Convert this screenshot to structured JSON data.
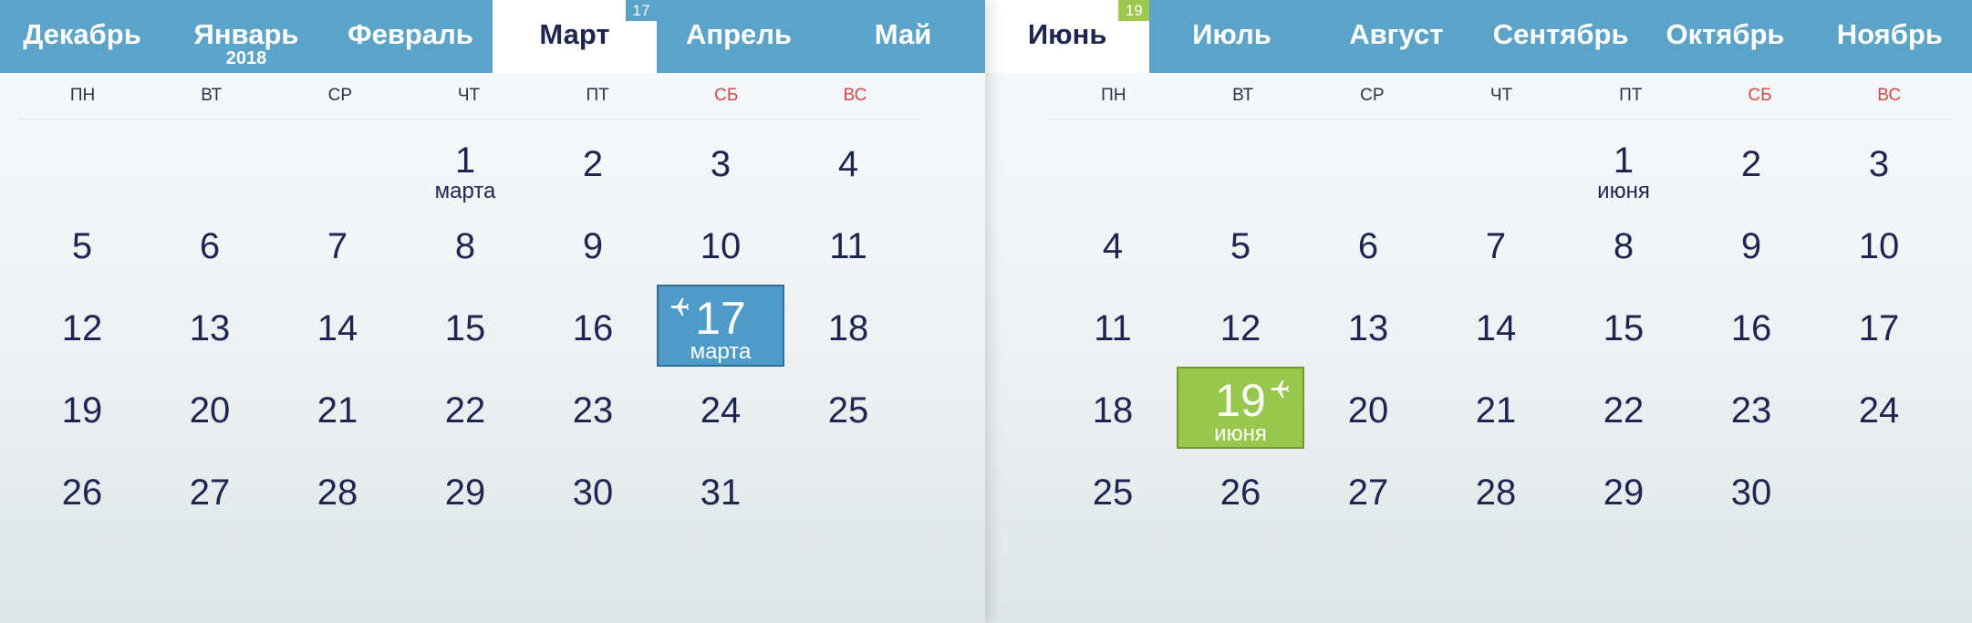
{
  "departure": {
    "tabs": [
      {
        "label": "Декабрь"
      },
      {
        "label": "Январь",
        "year": "2018"
      },
      {
        "label": "Февраль"
      },
      {
        "label": "Март",
        "active": true,
        "badge": "17"
      },
      {
        "label": "Апрель"
      },
      {
        "label": "Май"
      }
    ],
    "weekdays": [
      {
        "label": "ПН"
      },
      {
        "label": "ВТ"
      },
      {
        "label": "СР"
      },
      {
        "label": "ЧТ"
      },
      {
        "label": "ПТ"
      },
      {
        "label": "СБ",
        "weekend": true
      },
      {
        "label": "ВС",
        "weekend": true
      }
    ],
    "days": [
      {
        "empty": true
      },
      {
        "empty": true
      },
      {
        "empty": true
      },
      {
        "num": "1",
        "sub": "марта"
      },
      {
        "num": "2"
      },
      {
        "num": "3"
      },
      {
        "num": "4"
      },
      {
        "num": "5"
      },
      {
        "num": "6"
      },
      {
        "num": "7"
      },
      {
        "num": "8"
      },
      {
        "num": "9"
      },
      {
        "num": "10"
      },
      {
        "num": "11"
      },
      {
        "num": "12"
      },
      {
        "num": "13"
      },
      {
        "num": "14"
      },
      {
        "num": "15"
      },
      {
        "num": "16"
      },
      {
        "num": "17",
        "sub": "марта",
        "selected": true
      },
      {
        "num": "18"
      },
      {
        "num": "19"
      },
      {
        "num": "20"
      },
      {
        "num": "21"
      },
      {
        "num": "22"
      },
      {
        "num": "23"
      },
      {
        "num": "24"
      },
      {
        "num": "25"
      },
      {
        "num": "26"
      },
      {
        "num": "27"
      },
      {
        "num": "28"
      },
      {
        "num": "29"
      },
      {
        "num": "30"
      },
      {
        "num": "31"
      }
    ]
  },
  "return": {
    "tabs": [
      {
        "label": "Июнь",
        "active": true,
        "badge": "19"
      },
      {
        "label": "Июль"
      },
      {
        "label": "Август"
      },
      {
        "label": "Сентябрь"
      },
      {
        "label": "Октябрь"
      },
      {
        "label": "Ноябрь"
      }
    ],
    "weekdays": [
      {
        "label": "ПН"
      },
      {
        "label": "ВТ"
      },
      {
        "label": "СР"
      },
      {
        "label": "ЧТ"
      },
      {
        "label": "ПТ"
      },
      {
        "label": "СБ",
        "weekend": true
      },
      {
        "label": "ВС",
        "weekend": true
      }
    ],
    "days": [
      {
        "empty": true
      },
      {
        "empty": true
      },
      {
        "empty": true
      },
      {
        "empty": true
      },
      {
        "num": "1",
        "sub": "июня"
      },
      {
        "num": "2"
      },
      {
        "num": "3"
      },
      {
        "num": "4"
      },
      {
        "num": "5"
      },
      {
        "num": "6"
      },
      {
        "num": "7"
      },
      {
        "num": "8"
      },
      {
        "num": "9"
      },
      {
        "num": "10"
      },
      {
        "num": "11"
      },
      {
        "num": "12"
      },
      {
        "num": "13"
      },
      {
        "num": "14"
      },
      {
        "num": "15"
      },
      {
        "num": "16"
      },
      {
        "num": "17"
      },
      {
        "num": "18"
      },
      {
        "num": "19",
        "sub": "июня",
        "selected": true
      },
      {
        "num": "20"
      },
      {
        "num": "21"
      },
      {
        "num": "22"
      },
      {
        "num": "23"
      },
      {
        "num": "24"
      },
      {
        "num": "25"
      },
      {
        "num": "26"
      },
      {
        "num": "27"
      },
      {
        "num": "28"
      },
      {
        "num": "29"
      },
      {
        "num": "30"
      }
    ]
  },
  "icons": {
    "selected_day_icon": "airplane-icon"
  },
  "colors": {
    "tab_bar": "#5ba3c9",
    "departure_accent": "#4f9bc8",
    "return_accent": "#97c74c",
    "weekend_text": "#d04848",
    "day_text": "#1e2550"
  }
}
